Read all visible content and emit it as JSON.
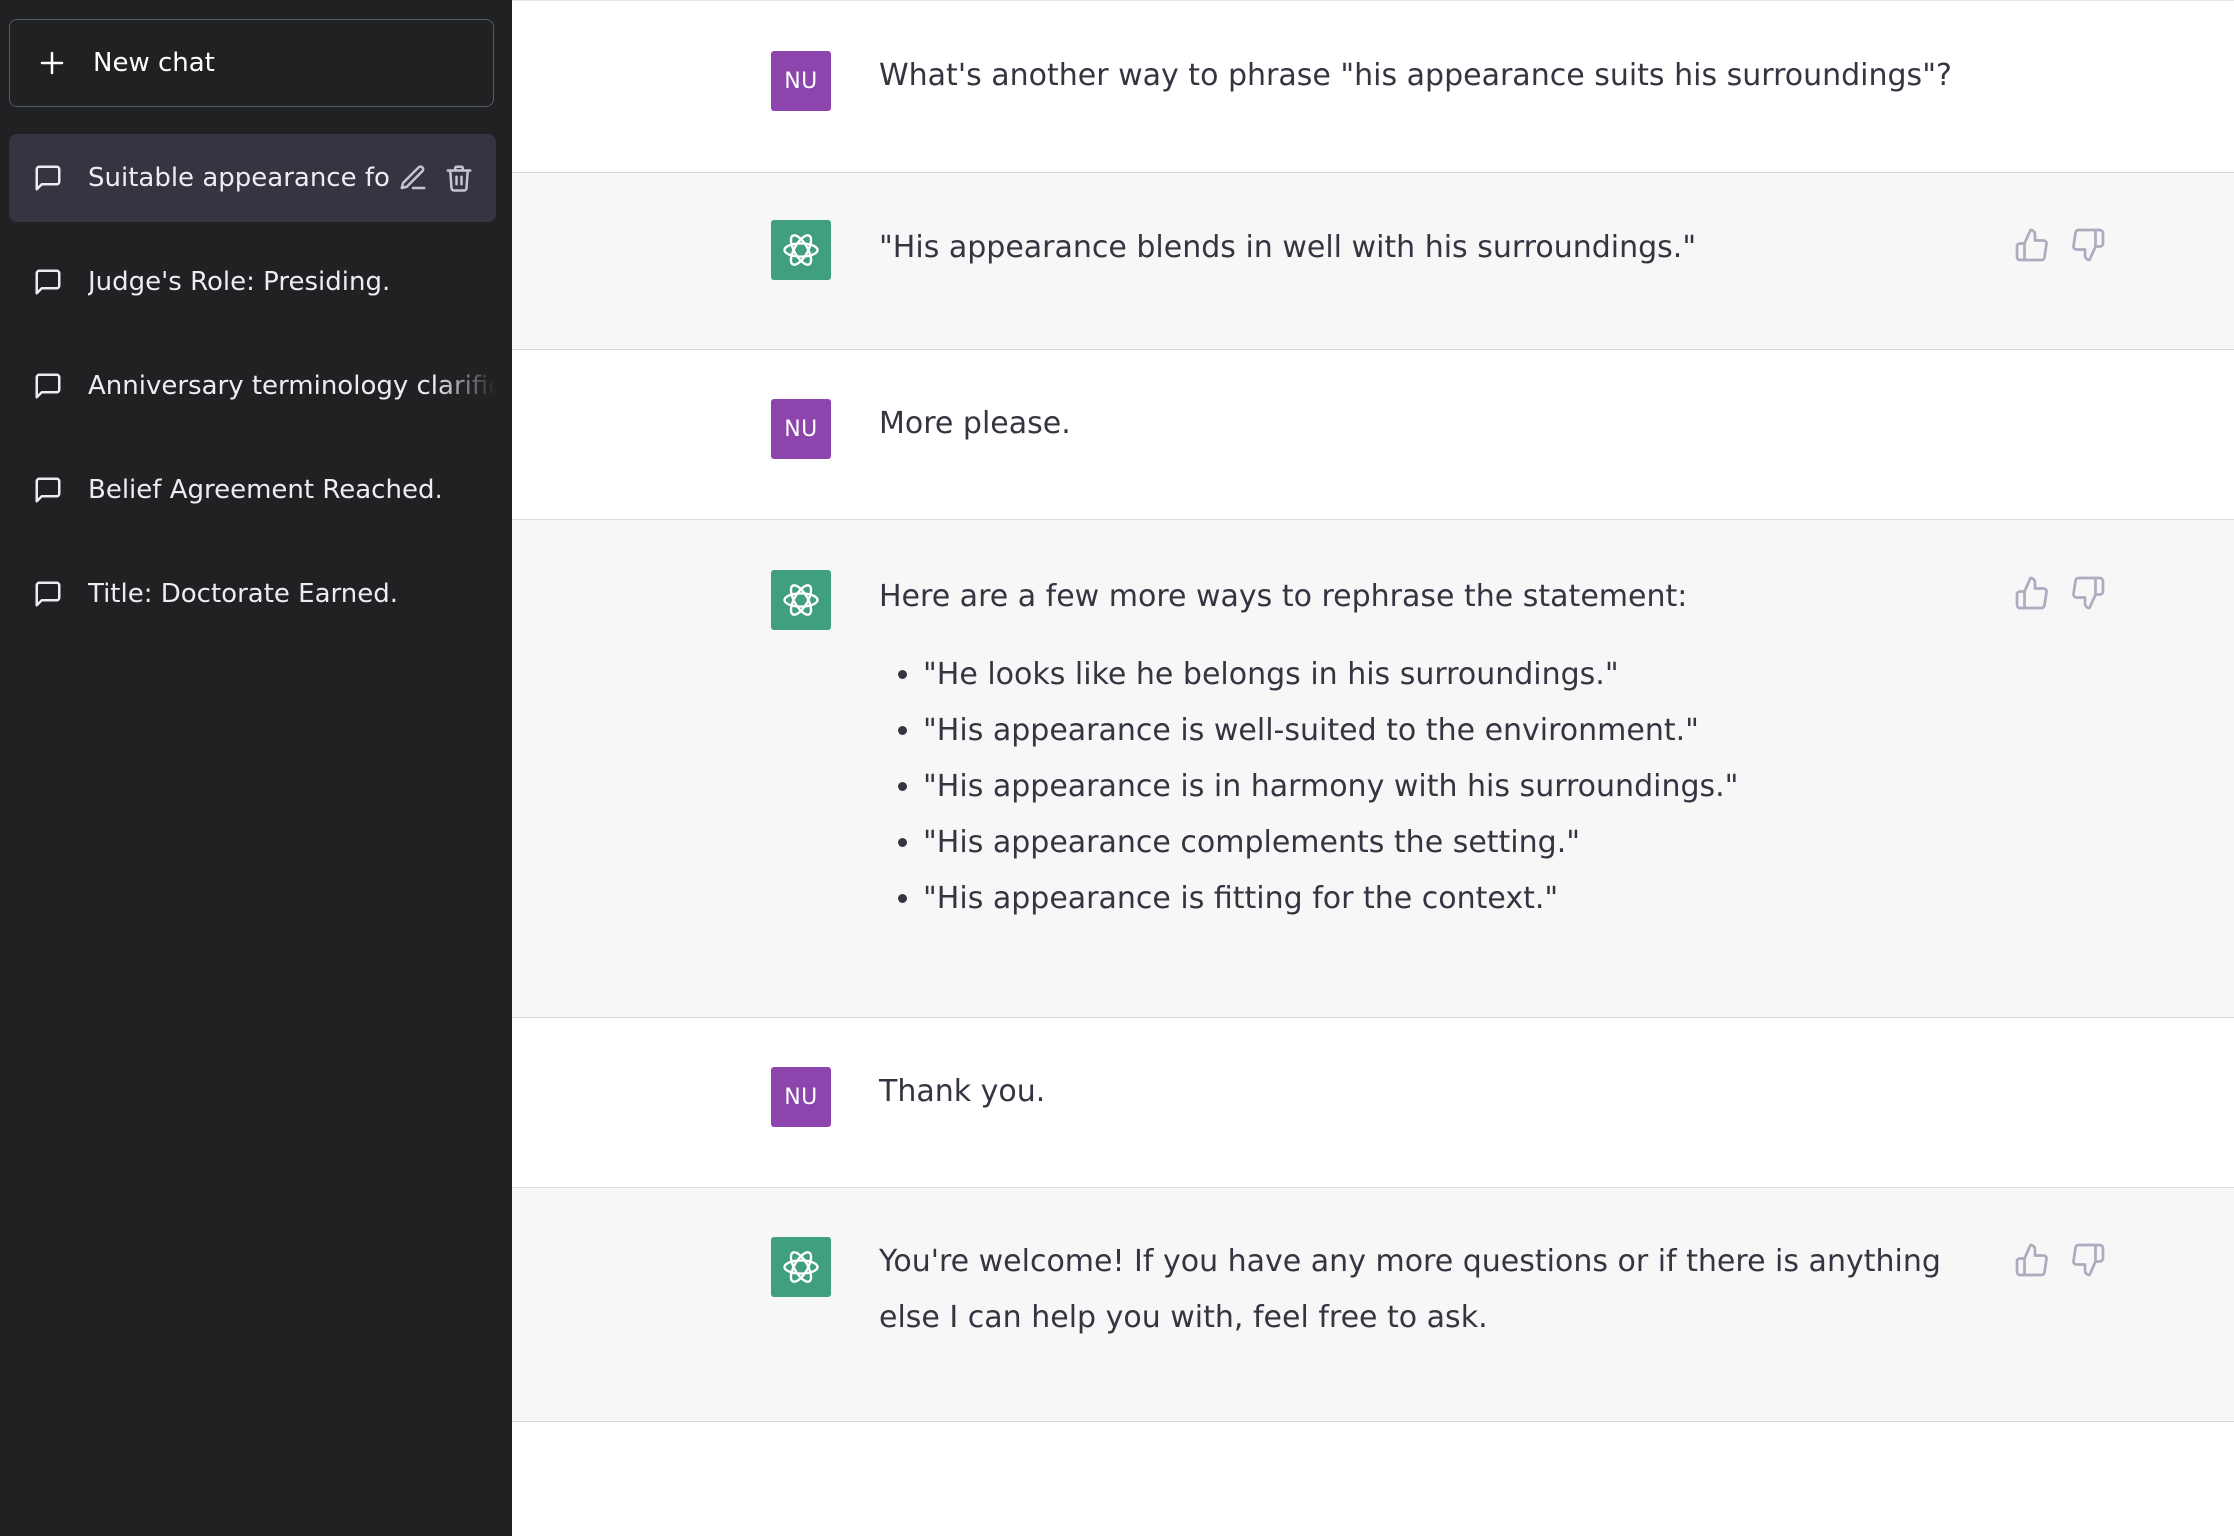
{
  "sidebar": {
    "new_chat_label": "New chat",
    "conversations": [
      {
        "title": "Suitable appearance fo",
        "active": true
      },
      {
        "title": "Judge's Role: Presiding.",
        "active": false
      },
      {
        "title": "Anniversary terminology clarification",
        "active": false
      },
      {
        "title": "Belief Agreement Reached.",
        "active": false
      },
      {
        "title": "Title: Doctorate Earned.",
        "active": false
      }
    ]
  },
  "chat": {
    "user_avatar_initials": "NU",
    "messages": [
      {
        "role": "user",
        "text": "What's another way to phrase \"his appearance suits his surroundings\"?"
      },
      {
        "role": "assistant",
        "text": "\"His appearance blends in well with his surroundings.\""
      },
      {
        "role": "user",
        "text": "More please."
      },
      {
        "role": "assistant",
        "intro": "Here are a few more ways to rephrase the statement:",
        "list": [
          "\"He looks like he belongs in his surroundings.\"",
          "\"His appearance is well-suited to the environment.\"",
          "\"His appearance is in harmony with his surroundings.\"",
          "\"His appearance complements the setting.\"",
          "\"His appearance is fitting for the context.\""
        ]
      },
      {
        "role": "user",
        "text": "Thank you."
      },
      {
        "role": "assistant",
        "text": "You're welcome! If you have any more questions or if there is anything else I can help you with, feel free to ask."
      }
    ]
  },
  "icons": {
    "new_chat": "plus-icon",
    "conversation": "chat-bubble-icon",
    "edit": "pencil-icon",
    "delete": "trash-icon",
    "assistant_avatar": "openai-logo-icon",
    "thumbs_up": "thumbs-up-icon",
    "thumbs_down": "thumbs-down-icon"
  },
  "colors": {
    "sidebar_bg": "#202123",
    "sidebar_active_bg": "#343541",
    "user_avatar_bg": "#8e44ad",
    "assistant_avatar_bg": "#3f9f80",
    "assistant_row_bg": "#f7f7f8",
    "text": "#343541"
  }
}
